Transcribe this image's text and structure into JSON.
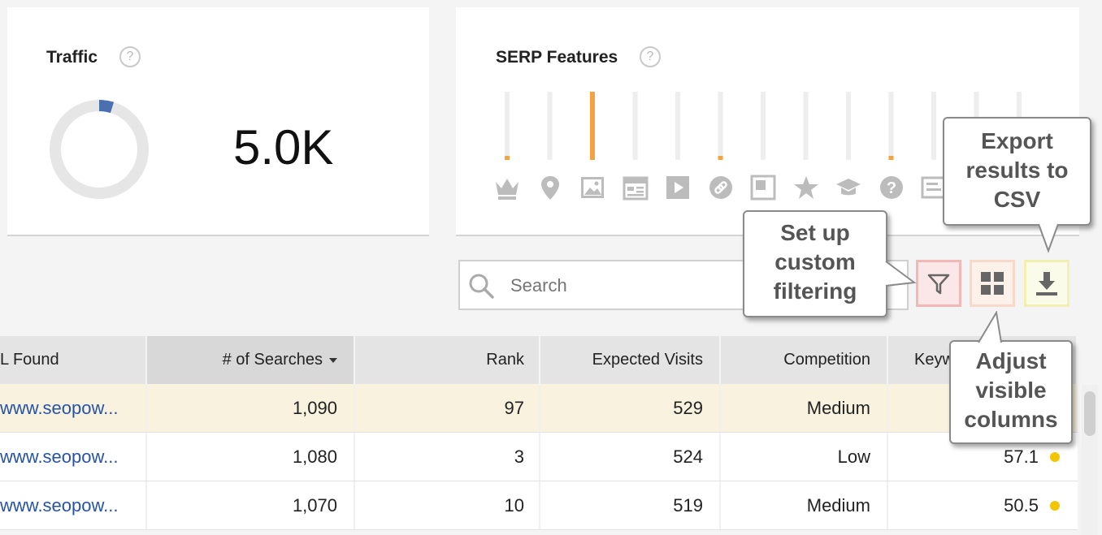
{
  "traffic": {
    "title": "Traffic",
    "help": "?",
    "value": "5.0K"
  },
  "serp": {
    "title": "SERP Features",
    "help": "?",
    "features": [
      {
        "icon": "crown-icon",
        "level": 0.03
      },
      {
        "icon": "map-pin-icon",
        "level": 0
      },
      {
        "icon": "image-icon",
        "level": 1.0
      },
      {
        "icon": "calendar-news-icon",
        "level": 0
      },
      {
        "icon": "video-play-icon",
        "level": 0
      },
      {
        "icon": "link-icon",
        "level": 0.03
      },
      {
        "icon": "featured-snippet-icon",
        "level": 0
      },
      {
        "icon": "star-icon",
        "level": 0
      },
      {
        "icon": "graduation-cap-icon",
        "level": 0
      },
      {
        "icon": "question-icon",
        "level": 0.03
      },
      {
        "icon": "ad-icon",
        "level": 0
      },
      {
        "icon": "feature-icon",
        "level": 0
      },
      {
        "icon": "feature-icon",
        "level": 0
      }
    ],
    "colors": {
      "active": "#f5a242",
      "inactive": "#eeeeee",
      "icon": "#bcbcbc"
    }
  },
  "search": {
    "placeholder": "Search",
    "value": ""
  },
  "toolbar": {
    "filter_icon": "filter-icon",
    "columns_icon": "grid-columns-icon",
    "export_icon": "download-icon"
  },
  "table": {
    "headers": [
      "L Found",
      "# of Searches",
      "Rank",
      "Expected Visits",
      "Competition",
      "Keyw"
    ],
    "rows": [
      {
        "url": "www.seopow...",
        "searches": "1,090",
        "rank": "97",
        "visits": "529",
        "competition": "Medium",
        "score": ""
      },
      {
        "url": "www.seopow...",
        "searches": "1,080",
        "rank": "3",
        "visits": "524",
        "competition": "Low",
        "score": "57.1"
      },
      {
        "url": "www.seopow...",
        "searches": "1,070",
        "rank": "10",
        "visits": "519",
        "competition": "Medium",
        "score": "50.5"
      }
    ]
  },
  "callouts": {
    "export": [
      "Export",
      "results to",
      "CSV"
    ],
    "filter": [
      "Set up",
      "custom",
      "filtering"
    ],
    "columns": [
      "Adjust",
      "visible",
      "columns"
    ]
  },
  "colors": {
    "accent": "#f5a242",
    "link": "#2653a7",
    "highlight_row": "#f8f2df",
    "donut_fill": "#4a70b0",
    "dot": "#f3c500"
  }
}
